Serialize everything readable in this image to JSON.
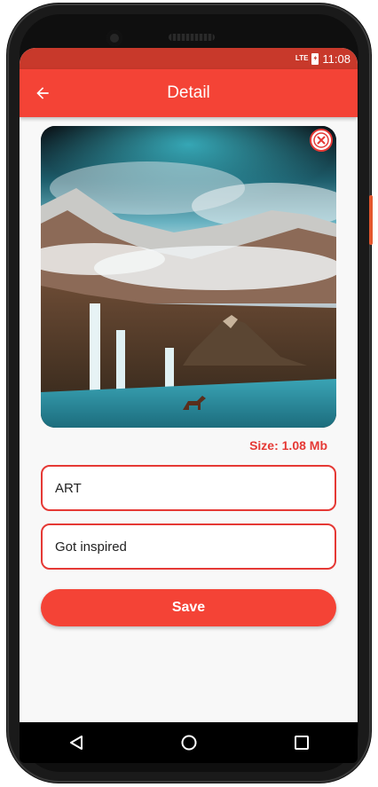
{
  "status_bar": {
    "network": "LTE",
    "time": "11:08"
  },
  "app_bar": {
    "title": "Detail",
    "back_icon": "arrow-left-icon"
  },
  "image": {
    "close_icon": "close-circle-icon"
  },
  "size_label": "Size: 1.08 Mb",
  "fields": {
    "category": {
      "value": "ART"
    },
    "caption": {
      "value": "Got inspired"
    }
  },
  "save_label": "Save",
  "nav": {
    "back_icon": "triangle-back-icon",
    "home_icon": "circle-home-icon",
    "recents_icon": "square-recents-icon"
  },
  "colors": {
    "primary": "#f44336",
    "status_bar": "#c8392b",
    "accent_text": "#e53935"
  }
}
